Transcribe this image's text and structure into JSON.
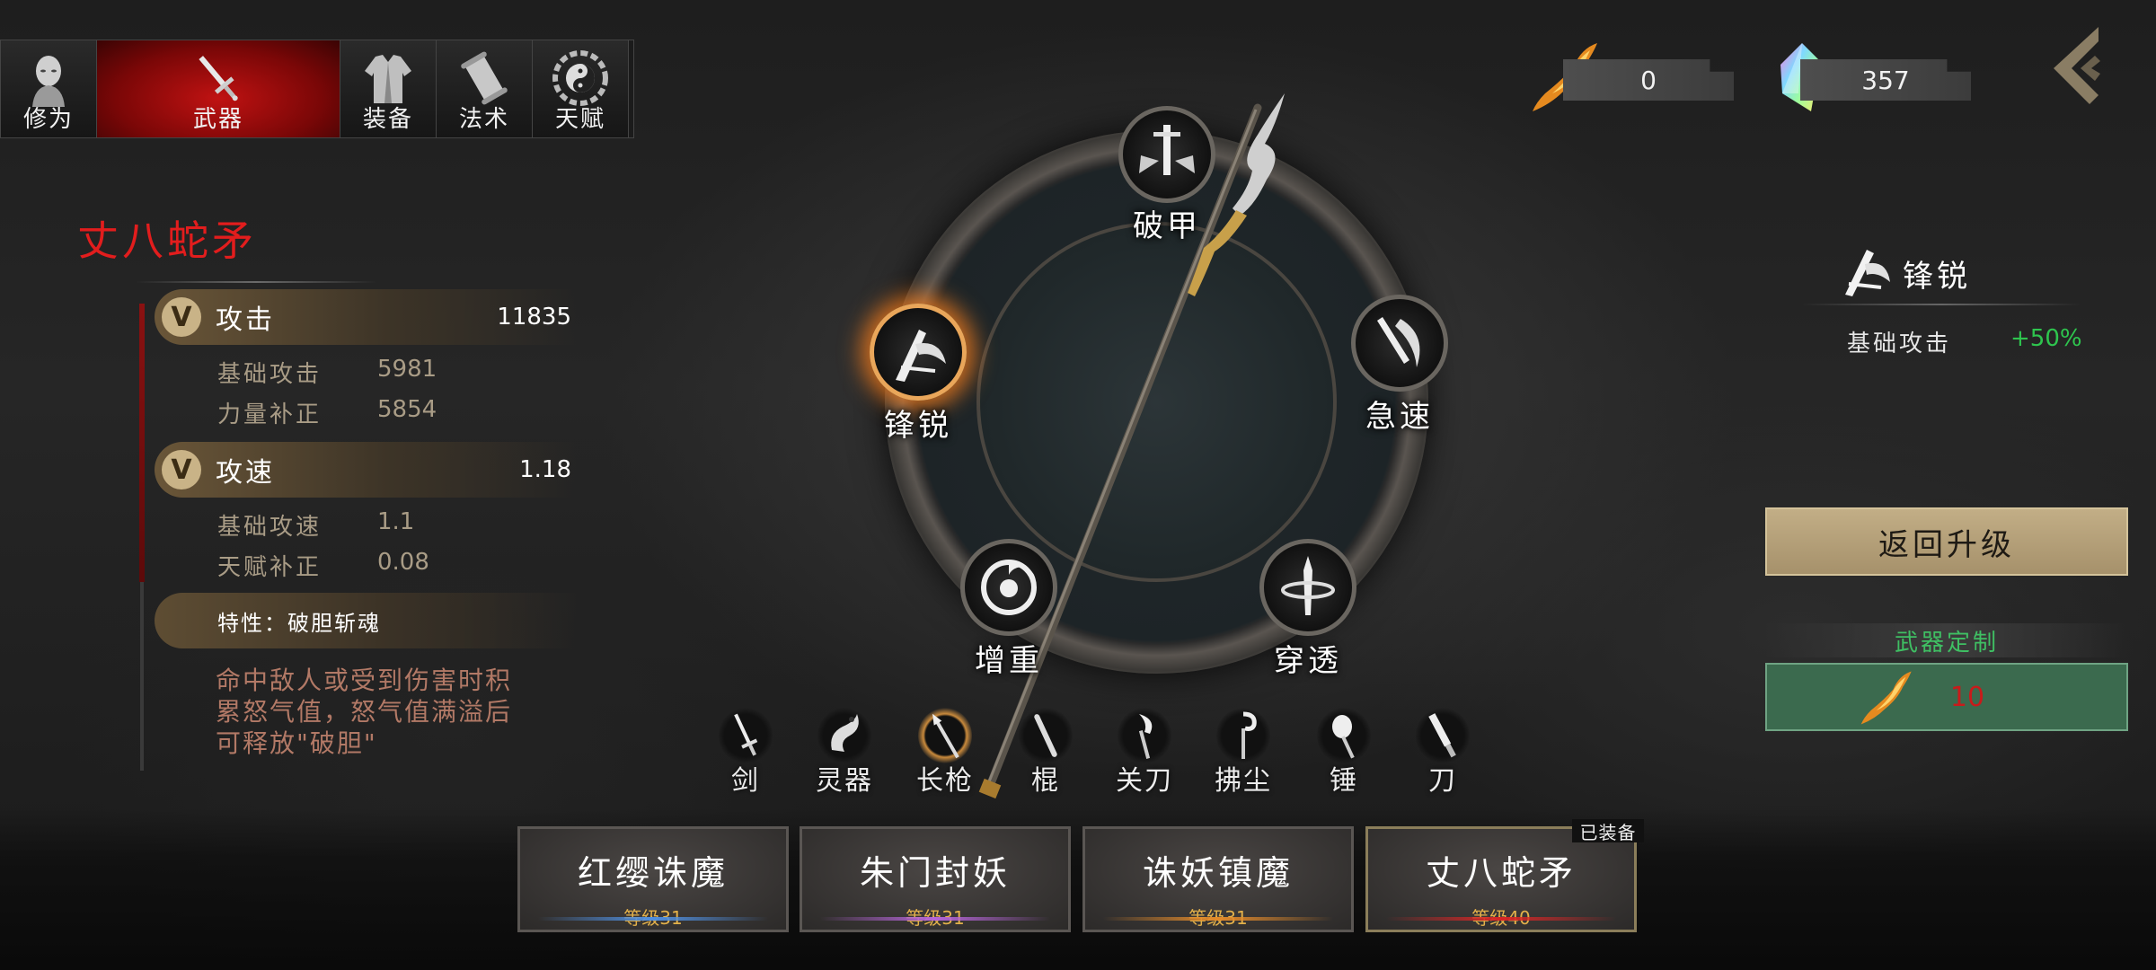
{
  "tabs": [
    {
      "label": "修为",
      "icon": "monk-head-icon",
      "active": false
    },
    {
      "label": "武器",
      "icon": "sword-icon",
      "active": true
    },
    {
      "label": "装备",
      "icon": "robe-icon",
      "active": false
    },
    {
      "label": "法术",
      "icon": "scroll-icon",
      "active": false
    },
    {
      "label": "天赋",
      "icon": "bagua-icon",
      "active": false
    }
  ],
  "currency": {
    "flame_shard": "0",
    "crystal": "357"
  },
  "weapon": {
    "name": "丈八蛇矛",
    "attack": {
      "label": "攻击",
      "value": "11835",
      "rows": [
        {
          "k": "基础攻击",
          "v": "5981"
        },
        {
          "k": "力量补正",
          "v": "5854"
        }
      ]
    },
    "speed": {
      "label": "攻速",
      "value": "1.18",
      "rows": [
        {
          "k": "基础攻速",
          "v": "1.1"
        },
        {
          "k": "天赋补正",
          "v": "0.08"
        }
      ]
    },
    "trait": "特性：破胆斩魂",
    "trait_desc": "命中敌人或受到伤害时积累怒气值，怒气值满溢后可释放\"破胆\""
  },
  "ring_nodes": [
    {
      "key": "pojia",
      "label": "破甲",
      "icon": "armor-break-icon",
      "active": false
    },
    {
      "key": "jisu",
      "label": "急速",
      "icon": "haste-icon",
      "active": false
    },
    {
      "key": "chuantou",
      "label": "穿透",
      "icon": "pierce-icon",
      "active": false
    },
    {
      "key": "zengzhong",
      "label": "增重",
      "icon": "weight-icon",
      "active": false
    },
    {
      "key": "fengrui",
      "label": "锋锐",
      "icon": "sharp-icon",
      "active": true
    }
  ],
  "selected": {
    "name": "锋锐",
    "stat_label": "基础攻击",
    "stat_value": "+50%"
  },
  "buttons": {
    "return_label": "返回升级",
    "custom_title": "武器定制",
    "custom_cost": "10"
  },
  "weapon_types": [
    {
      "label": "剑",
      "icon": "jian-sword-icon",
      "selected": false
    },
    {
      "label": "灵器",
      "icon": "dragon-artifact-icon",
      "selected": false
    },
    {
      "label": "长枪",
      "icon": "spear-icon",
      "selected": true
    },
    {
      "label": "棍",
      "icon": "staff-icon",
      "selected": false
    },
    {
      "label": "关刀",
      "icon": "guandao-icon",
      "selected": false
    },
    {
      "label": "拂尘",
      "icon": "whisk-icon",
      "selected": false
    },
    {
      "label": "锤",
      "icon": "hammer-icon",
      "selected": false
    },
    {
      "label": "刀",
      "icon": "dao-blade-icon",
      "selected": false
    }
  ],
  "weapon_cards": [
    {
      "name": "红缨诛魔",
      "level": "等级31",
      "color": "#4f8fe0",
      "lvcolor": "#e2b04a"
    },
    {
      "name": "朱门封妖",
      "level": "等级31",
      "color": "#b564d8",
      "lvcolor": "#e2b04a"
    },
    {
      "name": "诛妖镇魔",
      "level": "等级31",
      "color": "#e38a2a",
      "lvcolor": "#e2b04a"
    },
    {
      "name": "丈八蛇矛",
      "level": "等级40",
      "color": "#d62525",
      "lvcolor": "#e2b04a",
      "equipped": true
    }
  ],
  "equipped_tag": "已装备"
}
